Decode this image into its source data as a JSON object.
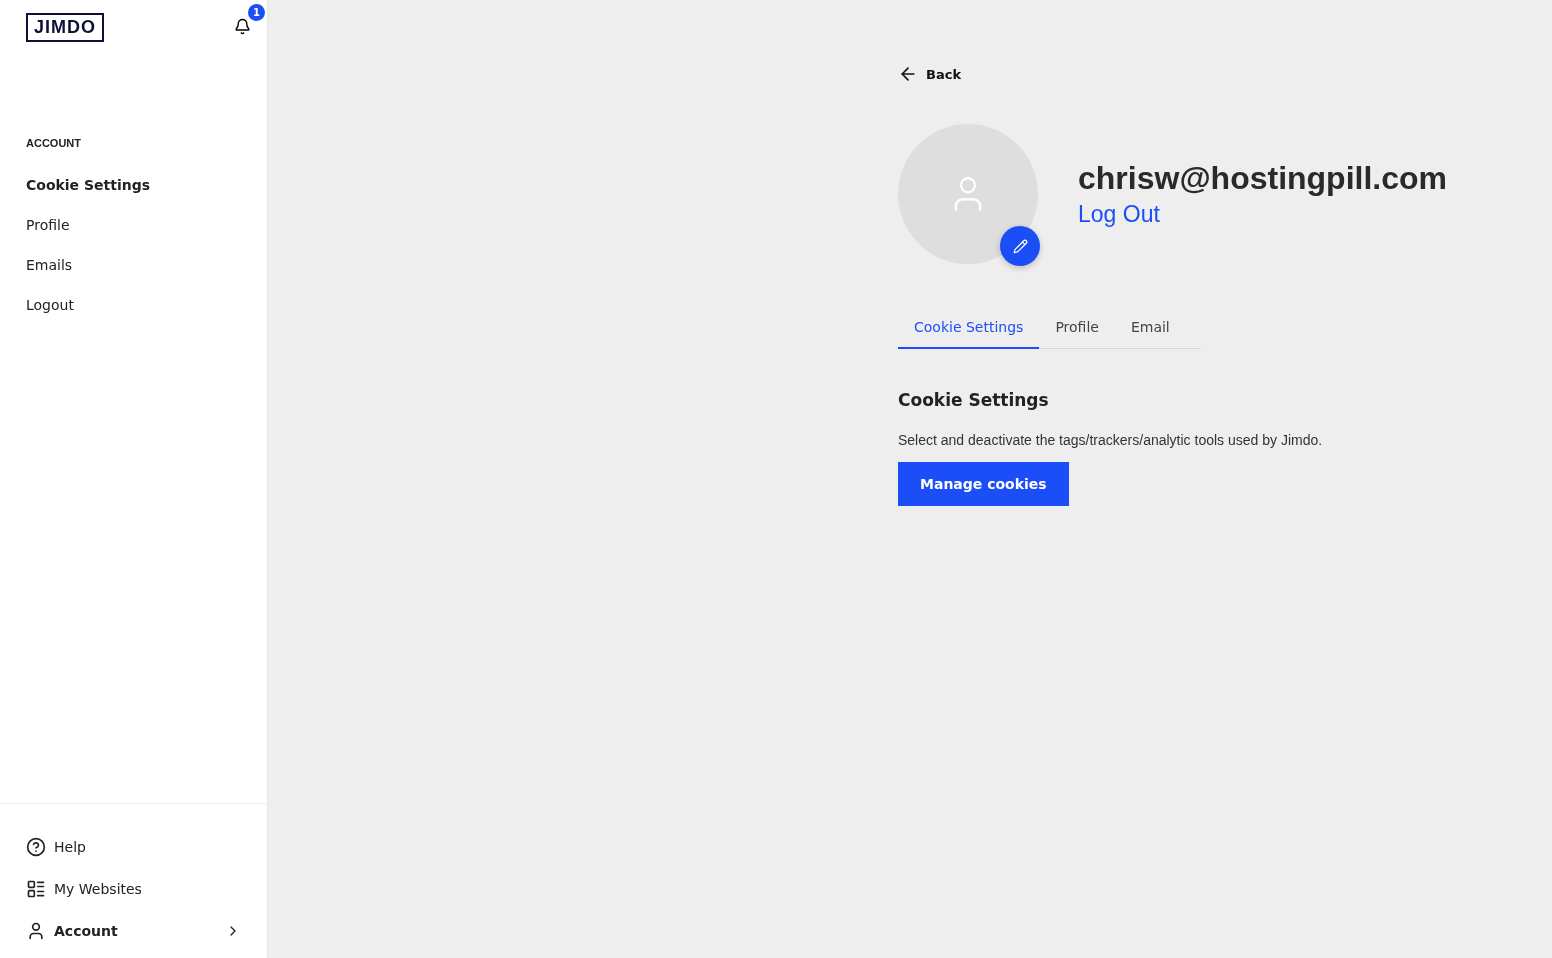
{
  "sidebar": {
    "logo": "JIMDO",
    "notification_count": "1",
    "section_title": "ACCOUNT",
    "items": [
      {
        "label": "Cookie Settings",
        "selected": true
      },
      {
        "label": "Profile",
        "selected": false
      },
      {
        "label": "Emails",
        "selected": false
      },
      {
        "label": "Logout",
        "selected": false
      }
    ],
    "footer_items": [
      {
        "label": "Help",
        "kind": "help",
        "selected": false
      },
      {
        "label": "My Websites",
        "kind": "websites",
        "selected": false
      },
      {
        "label": "Account",
        "kind": "account",
        "selected": true
      }
    ]
  },
  "main": {
    "back": "Back",
    "email": "chrisw@hostingpill.com",
    "logout": "Log Out",
    "tabs": [
      {
        "label": "Cookie Settings",
        "selected": true
      },
      {
        "label": "Profile",
        "selected": false
      },
      {
        "label": "Email",
        "selected": false
      }
    ],
    "section_title": "Cookie Settings",
    "description": "Select and deactivate the tags/trackers/analytic tools used by Jimdo.",
    "button": "Manage cookies"
  }
}
